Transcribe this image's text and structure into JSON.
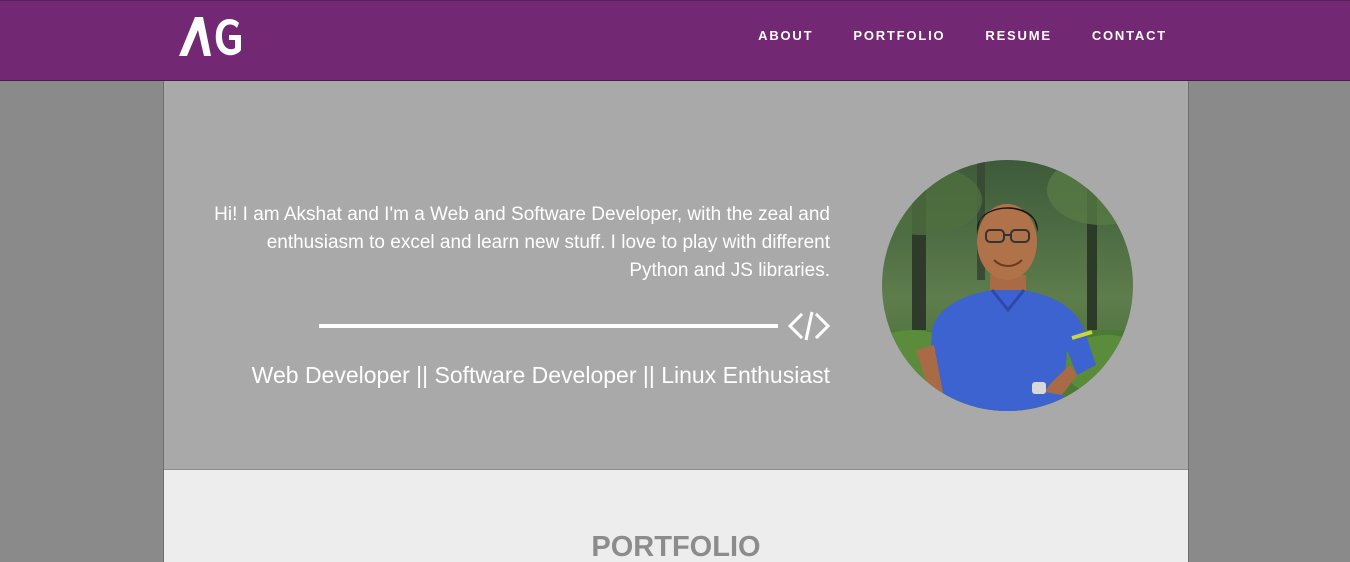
{
  "navbar": {
    "logo_text": "AG",
    "links": [
      {
        "label": "ABOUT"
      },
      {
        "label": "PORTFOLIO"
      },
      {
        "label": "RESUME"
      },
      {
        "label": "CONTACT"
      }
    ]
  },
  "hero": {
    "intro": "Hi! I am Akshat and I'm a Web and Software Developer, with the zeal and enthusiasm to excel and learn new stuff. I love to play with different Python and JS libraries.",
    "tagline": "Web Developer || Software Developer || Linux Enthusiast",
    "divider_icon": "code-icon",
    "avatar_icon": "profile-photo"
  },
  "portfolio": {
    "heading": "PORTFOLIO"
  },
  "colors": {
    "navbar": "#722872",
    "hero_bg": "#a9a9a9",
    "page_bg": "#8a8a8a",
    "section_bg": "#ededed",
    "heading": "#8c8c8c"
  }
}
